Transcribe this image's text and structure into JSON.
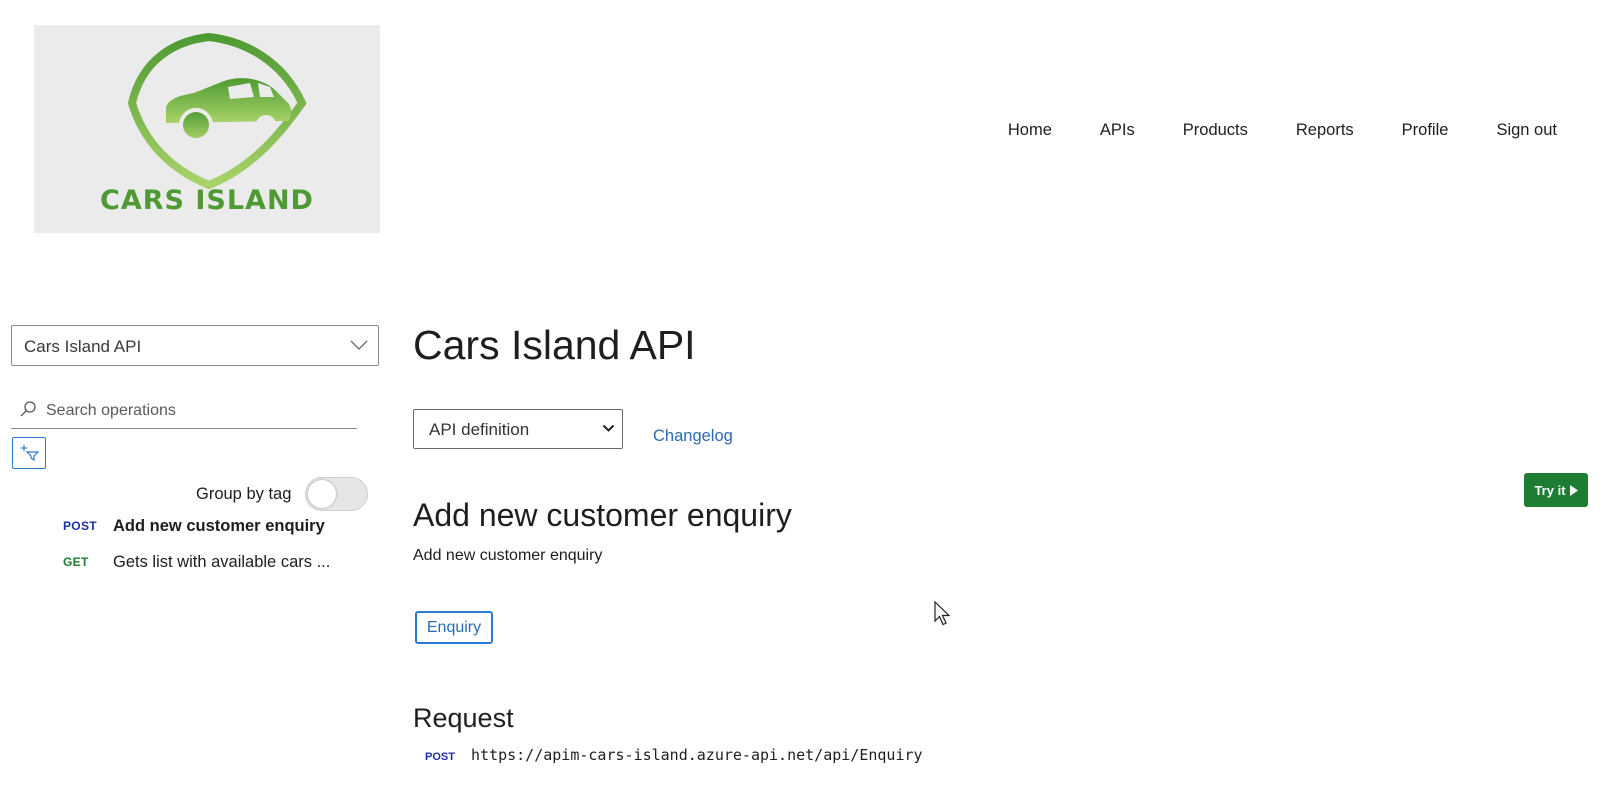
{
  "logo": {
    "text": "CARS ISLAND"
  },
  "nav": {
    "items": [
      "Home",
      "APIs",
      "Products",
      "Reports",
      "Profile",
      "Sign out"
    ]
  },
  "sidebar": {
    "api_select_value": "Cars Island API",
    "search_placeholder": "Search operations",
    "group_by_tag_label": "Group by tag",
    "group_by_tag_on": false,
    "operations": [
      {
        "method": "POST",
        "method_color": "#1c2fa8",
        "name": "Add new customer enquiry",
        "selected": true
      },
      {
        "method": "GET",
        "method_color": "#1c7d33",
        "name": "Gets list with available cars ...",
        "selected": false
      }
    ]
  },
  "main": {
    "api_title": "Cars Island API",
    "definition_select_value": "API definition",
    "changelog_label": "Changelog",
    "try_it_label": "Try it",
    "operation_title": "Add new customer enquiry",
    "operation_description": "Add new customer enquiry",
    "tag_label": "Enquiry",
    "request_heading": "Request",
    "request_method": "POST",
    "request_url": "https://apim-cars-island.azure-api.net/api/Enquiry"
  },
  "colors": {
    "brand_green": "#4f9a34",
    "link_blue": "#2b6cb0",
    "try_it_green": "#1c7d33"
  }
}
